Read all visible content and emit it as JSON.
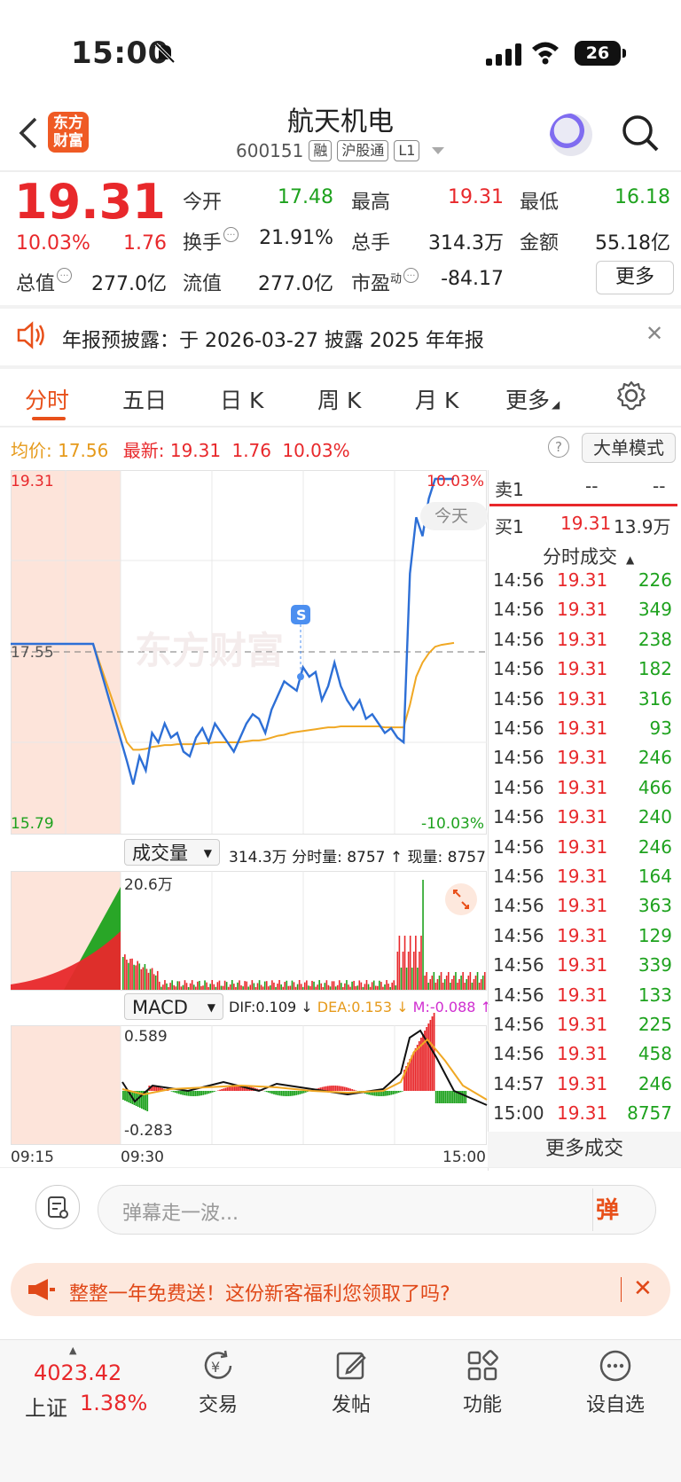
{
  "status": {
    "time": "15:00",
    "battery": "26"
  },
  "header": {
    "name": "航天机电",
    "code": "600151",
    "tags": [
      "融",
      "沪股通",
      "L1"
    ],
    "logo_line1": "东方",
    "logo_line2": "财富"
  },
  "quote": {
    "price": "19.31",
    "pct": "10.03%",
    "change": "1.76",
    "open_label": "今开",
    "open": "17.48",
    "high_label": "最高",
    "high": "19.31",
    "low_label": "最低",
    "low": "16.18",
    "turnover_label": "换手",
    "turnover": "21.91%",
    "volume_label": "总手",
    "volume": "314.3万",
    "amount_label": "金额",
    "amount": "55.18亿",
    "mcap_label": "总值",
    "mcap": "277.0亿",
    "float_label": "流值",
    "float": "277.0亿",
    "pe_label": "市盈",
    "pe_sup": "动",
    "pe": "-84.17",
    "more": "更多"
  },
  "notice": {
    "text": "年报预披露：于 2026-03-27 披露 2025 年年报"
  },
  "tabs": [
    "分时",
    "五日",
    "日 K",
    "周 K",
    "月 K",
    "更多"
  ],
  "summary": {
    "avg_label": "均价:",
    "avg": "17.56",
    "latest_label": "最新:",
    "latest": "19.31",
    "chg": "1.76",
    "pct": "10.03%",
    "help": "?",
    "bigmode": "大单模式"
  },
  "chart_data": {
    "type": "line",
    "title": "",
    "y_max_label": "19.31",
    "y_min_label": "15.79",
    "ref_label": "17.55",
    "top_pct": "10.03%",
    "bottom_pct": "-10.03%",
    "today_label": "今天",
    "watermark": "东方财富",
    "x_labels": [
      "09:15",
      "09:30",
      "15:00"
    ],
    "ylim": [
      15.79,
      19.31
    ],
    "prev_close": 17.55,
    "price_series": [
      17.55,
      17.55,
      17.55,
      17.55,
      16.3,
      16.05,
      16.35,
      16.2,
      16.6,
      16.5,
      16.7,
      16.55,
      16.6,
      16.4,
      16.35,
      16.55,
      16.65,
      16.5,
      16.7,
      16.6,
      16.5,
      16.4,
      16.55,
      16.7,
      16.8,
      16.75,
      16.6,
      16.85,
      17.0,
      17.15,
      17.1,
      17.05,
      17.3,
      17.2,
      17.25,
      16.95,
      17.1,
      17.35,
      17.1,
      16.95,
      16.85,
      16.95,
      16.75,
      16.8,
      16.7,
      16.6,
      16.65,
      16.55,
      16.5,
      18.3,
      18.9,
      18.7,
      19.1,
      19.31,
      19.31,
      19.31,
      19.31
    ],
    "avg_series": [
      17.55,
      17.55,
      17.55,
      17.55,
      16.5,
      16.42,
      16.42,
      16.43,
      16.45,
      16.46,
      16.47,
      16.47,
      16.48,
      16.48,
      16.48,
      16.48,
      16.49,
      16.49,
      16.5,
      16.5,
      16.5,
      16.5,
      16.5,
      16.51,
      16.52,
      16.52,
      16.53,
      16.55,
      16.57,
      16.58,
      16.6,
      16.61,
      16.62,
      16.63,
      16.64,
      16.65,
      16.66,
      16.66,
      16.67,
      16.67,
      16.67,
      16.67,
      16.67,
      16.67,
      16.67,
      16.66,
      16.66,
      16.66,
      16.66,
      16.9,
      17.2,
      17.35,
      17.45,
      17.52,
      17.54,
      17.55,
      17.56
    ],
    "volume_label": "20.6万",
    "macd_top": "0.589",
    "macd_bottom": "-0.283"
  },
  "volume_header": {
    "label": "成交量",
    "info": "314.3万 分时量: 8757 ↑ 现量: 8757"
  },
  "macd_header": {
    "label": "MACD",
    "dif": "DIF:0.109 ↓",
    "dea": "DEA:0.153 ↓",
    "m": "M:-0.088 ↑"
  },
  "orderbook": {
    "sell_label": "卖1",
    "sell_price": "--",
    "sell_vol": "--",
    "buy_label": "买1",
    "buy_price": "19.31",
    "buy_vol": "13.9万"
  },
  "ticks_title": "分时成交",
  "ticks": [
    {
      "t": "14:56",
      "p": "19.31",
      "v": "226"
    },
    {
      "t": "14:56",
      "p": "19.31",
      "v": "349"
    },
    {
      "t": "14:56",
      "p": "19.31",
      "v": "238"
    },
    {
      "t": "14:56",
      "p": "19.31",
      "v": "182"
    },
    {
      "t": "14:56",
      "p": "19.31",
      "v": "316"
    },
    {
      "t": "14:56",
      "p": "19.31",
      "v": "93"
    },
    {
      "t": "14:56",
      "p": "19.31",
      "v": "246"
    },
    {
      "t": "14:56",
      "p": "19.31",
      "v": "466"
    },
    {
      "t": "14:56",
      "p": "19.31",
      "v": "240"
    },
    {
      "t": "14:56",
      "p": "19.31",
      "v": "246"
    },
    {
      "t": "14:56",
      "p": "19.31",
      "v": "164"
    },
    {
      "t": "14:56",
      "p": "19.31",
      "v": "363"
    },
    {
      "t": "14:56",
      "p": "19.31",
      "v": "129"
    },
    {
      "t": "14:56",
      "p": "19.31",
      "v": "339"
    },
    {
      "t": "14:56",
      "p": "19.31",
      "v": "133"
    },
    {
      "t": "14:56",
      "p": "19.31",
      "v": "225"
    },
    {
      "t": "14:56",
      "p": "19.31",
      "v": "458"
    },
    {
      "t": "14:57",
      "p": "19.31",
      "v": "246"
    },
    {
      "t": "15:00",
      "p": "19.31",
      "v": "8757"
    }
  ],
  "more_trades": "更多成交",
  "comment": {
    "placeholder": "弹幕走一波...",
    "send": "弹"
  },
  "promo": {
    "text": "整整一年免费送！这份新客福利您领取了吗?"
  },
  "bottom": {
    "index_value": "4023.42",
    "index_name": "上证",
    "index_pct": "1.38%",
    "nav": [
      "交易",
      "发帖",
      "功能",
      "设自选"
    ]
  }
}
